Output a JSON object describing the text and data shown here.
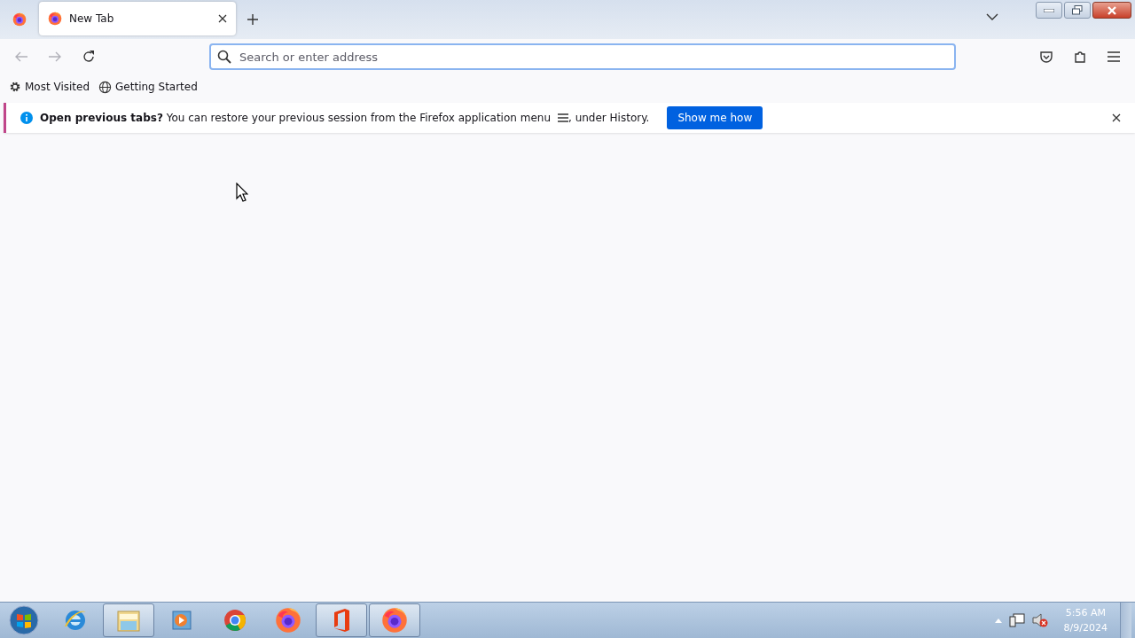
{
  "tabs": [
    {
      "title": "New Tab",
      "selected": true
    }
  ],
  "address_bar": {
    "placeholder": "Search or enter address"
  },
  "bookmarks": [
    {
      "kind": "gear",
      "label": "Most Visited"
    },
    {
      "kind": "globe",
      "label": "Getting Started"
    }
  ],
  "notification": {
    "message": "**Open previous tabs?** You can restore your previous session from the Firefox application menu",
    "message_end": ", under History.",
    "button": "Show me how"
  },
  "taskbar": {
    "items": [
      {
        "kind": "ie",
        "running": false
      },
      {
        "kind": "folder",
        "running": true
      },
      {
        "kind": "media",
        "running": false
      },
      {
        "kind": "chrome",
        "running": false
      },
      {
        "kind": "firefox",
        "running": false
      },
      {
        "kind": "office",
        "running": true
      },
      {
        "kind": "firefox",
        "running": true
      }
    ],
    "time": "5:56 AM",
    "date": "8/9/2024"
  }
}
